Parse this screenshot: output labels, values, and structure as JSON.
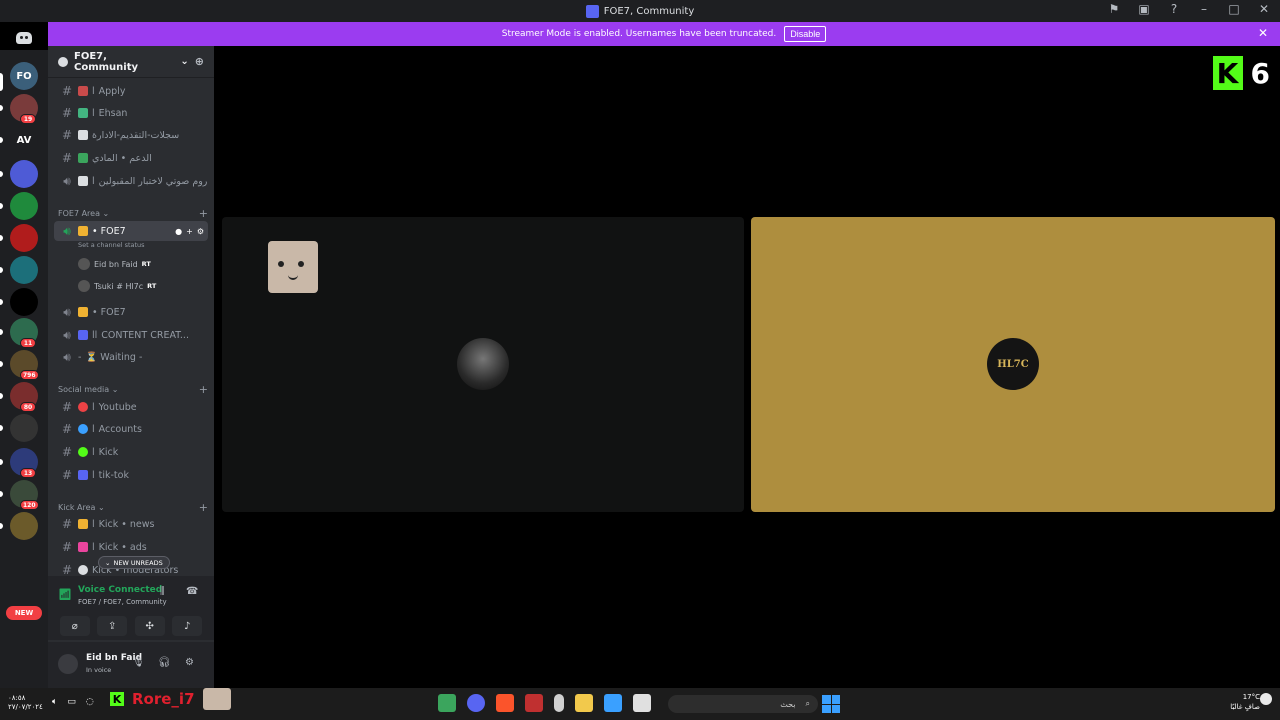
{
  "window": {
    "title": "FOE7, Community"
  },
  "banner": {
    "text": "Streamer Mode is enabled. Usernames have been truncated.",
    "button": "Disable"
  },
  "rail": {
    "servers": [
      {
        "abbr": "FO",
        "color": "#3b5f7a"
      },
      {
        "abbr": "",
        "color": "#7a3b3b",
        "badge": "19"
      },
      {
        "abbr": "AV",
        "color": "#1e1f22"
      },
      {
        "abbr": "",
        "color": "#4e5bd6"
      },
      {
        "abbr": "",
        "color": "#1f8a3c"
      },
      {
        "abbr": "",
        "color": "#b01c1c"
      },
      {
        "abbr": "",
        "color": "#1c6f7a"
      },
      {
        "abbr": "",
        "color": "#000000"
      },
      {
        "abbr": "",
        "color": "#2d6b4e",
        "badge": "11"
      },
      {
        "abbr": "",
        "color": "#5b4a2a",
        "badge": "796"
      },
      {
        "abbr": "",
        "color": "#7a2d2d",
        "badge": "80"
      },
      {
        "abbr": "",
        "color": "#333333"
      },
      {
        "abbr": "",
        "color": "#2d3b7a",
        "badge": "13"
      },
      {
        "abbr": "",
        "color": "#3a4a3a",
        "badge": "120"
      },
      {
        "abbr": "",
        "color": "#6b5a2a"
      }
    ],
    "new_label": "NEW"
  },
  "guild": {
    "name": "FOE7, Community"
  },
  "channels_top": [
    {
      "name": "Apply",
      "prefix": "l",
      "type": "text",
      "emoji_color": "#c94b4b"
    },
    {
      "name": "Ehsan",
      "prefix": "l",
      "type": "text",
      "emoji_color": "#43b581"
    },
    {
      "name": "سجلات-التقديم-الادارة",
      "prefix": "",
      "type": "text",
      "emoji_color": "#dbdee1"
    },
    {
      "name": "الدعم • المادي",
      "prefix": "",
      "type": "text",
      "emoji_color": "#3ba55d"
    },
    {
      "name": "روم صوتي لاختبار المقبولين",
      "prefix": "l",
      "type": "voice",
      "emoji_color": "#dbdee1"
    }
  ],
  "cat_foe7": "FOE7 Area",
  "voice_channel_active": {
    "name": "• FOE7",
    "status": "Set a channel status"
  },
  "voice_users": [
    {
      "name": "Eid bn Faid",
      "tag": "RT"
    },
    {
      "name": "Tsuki # Hl7c",
      "tag": "RT"
    }
  ],
  "voice_channels_more": [
    {
      "name": "• FOE7",
      "emoji_color": "#f0b232"
    },
    {
      "name": "CONTENT CREAT...",
      "prefix": "ll",
      "emoji_color": "#5865f2"
    },
    {
      "name": "⏳ Waiting -",
      "prefix": "-",
      "emoji_color": ""
    }
  ],
  "cat_social": "Social media",
  "social_channels": [
    {
      "name": "Youtube",
      "prefix": "l",
      "emoji_color": "#ed4245"
    },
    {
      "name": "Accounts",
      "prefix": "l",
      "emoji_color": "#3ba0ff"
    },
    {
      "name": "Kick",
      "prefix": "l",
      "emoji_color": "#53fc18"
    },
    {
      "name": "tik-tok",
      "prefix": "l",
      "emoji_color": "#5865f2"
    }
  ],
  "cat_kick": "Kick Area",
  "kick_channels": [
    {
      "name": "Kick • news",
      "prefix": "l",
      "emoji_color": "#f0b232"
    },
    {
      "name": "Kick • ads",
      "prefix": "l",
      "emoji_color": "#eb459e"
    },
    {
      "name": "Kick • moderators",
      "prefix": "",
      "emoji_color": "#dbdee1"
    }
  ],
  "new_unreads": "NEW UNREADS",
  "voice_panel": {
    "title": "Voice Connected",
    "subtitle": "FOE7 / FOE7, Community"
  },
  "user": {
    "name": "Eid bn Faid",
    "status": "In voice"
  },
  "stream_overlay": {
    "kick_letter": "K",
    "number": "6"
  },
  "tile_right_avatar_text": "HL7C",
  "taskbar": {
    "left_time": "٠٨:٥٨",
    "left_date": "٢٧/٠٧/٢٠٢٤",
    "overlay_name": "Rore_i7",
    "search_placeholder": "بحث",
    "weather_temp": "17°C",
    "weather_desc": "صافٍ غالبًا"
  }
}
